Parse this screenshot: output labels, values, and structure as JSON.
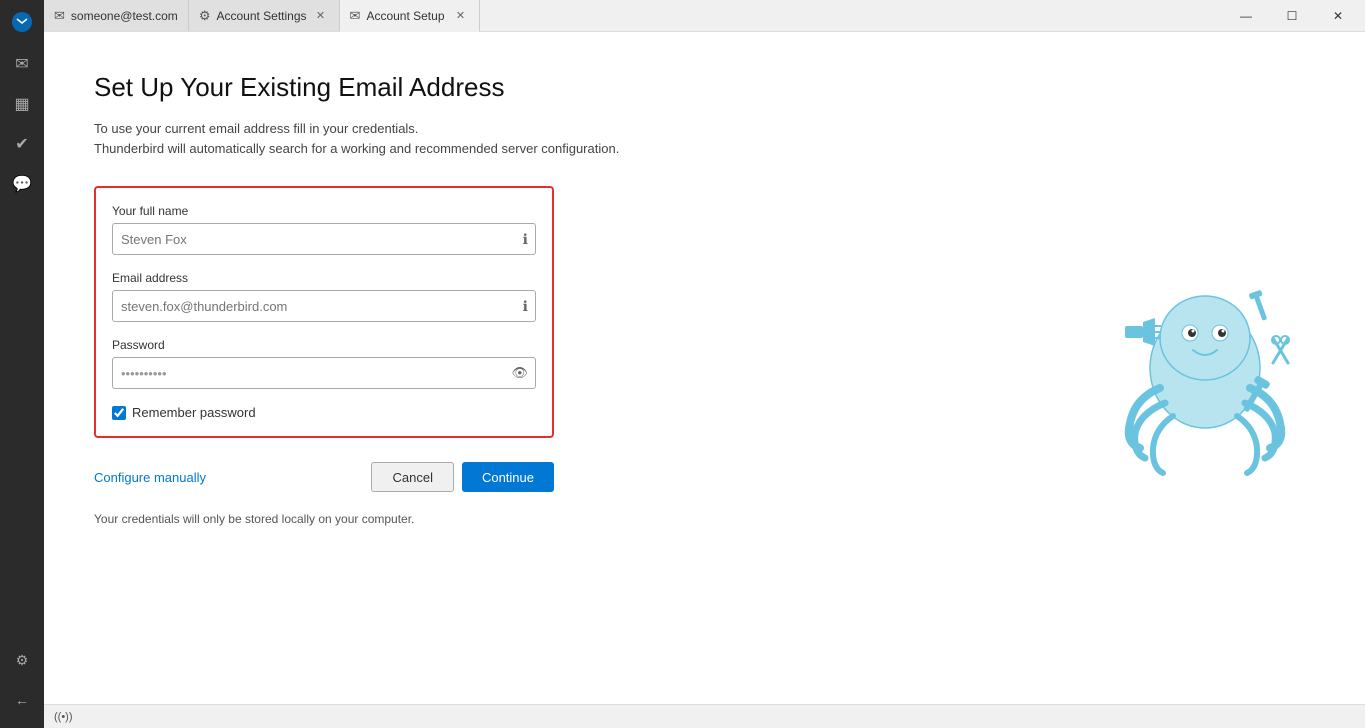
{
  "sidebar": {
    "icons": [
      {
        "name": "email-icon",
        "glyph": "✉",
        "label": "Mail"
      },
      {
        "name": "calendar-icon",
        "glyph": "📅",
        "label": "Calendar"
      },
      {
        "name": "tasks-icon",
        "glyph": "✓",
        "label": "Tasks"
      },
      {
        "name": "chat-icon",
        "glyph": "💬",
        "label": "Chat"
      }
    ],
    "bottom_icons": [
      {
        "name": "settings-icon",
        "glyph": "⚙",
        "label": "Settings"
      },
      {
        "name": "back-icon",
        "glyph": "←",
        "label": "Back"
      }
    ]
  },
  "titlebar": {
    "tabs": [
      {
        "id": "tab-email",
        "label": "someone@test.com",
        "icon": "✉",
        "closable": false,
        "active": false
      },
      {
        "id": "tab-settings",
        "label": "Account Settings",
        "icon": "⚙",
        "closable": true,
        "active": false
      },
      {
        "id": "tab-setup",
        "label": "Account Setup",
        "icon": "✉",
        "closable": true,
        "active": true
      }
    ],
    "window_controls": {
      "minimize": "—",
      "maximize": "☐",
      "close": "✕"
    }
  },
  "page": {
    "title": "Set Up Your Existing Email Address",
    "subtitle_line1": "To use your current email address fill in your credentials.",
    "subtitle_line2": "Thunderbird will automatically search for a working and recommended server configuration.",
    "form": {
      "full_name_label": "Your full name",
      "full_name_placeholder": "Steven Fox",
      "full_name_value": "Steven Fox",
      "email_label": "Email address",
      "email_placeholder": "steven.fox@thunderbird.com",
      "email_value": "steven.fox@thunderbird.com",
      "password_label": "Password",
      "password_value": "••••••••••",
      "remember_label": "Remember password",
      "remember_checked": true
    },
    "actions": {
      "configure_manually": "Configure manually",
      "cancel": "Cancel",
      "continue": "Continue"
    },
    "footer_note": "Your credentials will only be stored locally on your computer."
  },
  "statusbar": {
    "wifi_icon": "((•))",
    "wifi_label": ""
  }
}
